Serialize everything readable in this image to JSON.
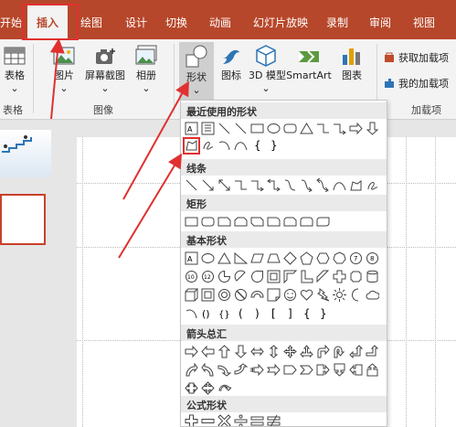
{
  "tabs": [
    "开始",
    "插入",
    "绘图",
    "设计",
    "切换",
    "动画",
    "幻灯片放映",
    "录制",
    "审阅",
    "视图"
  ],
  "ribbon": {
    "table": "表格",
    "picture": "图片",
    "screenshot": "屏幕截图",
    "album": "相册",
    "shapes": "形状",
    "icons": "图标",
    "models3d": "3D 模型",
    "smartart": "SmartArt",
    "chart": "图表",
    "get_addins": "获取加载项",
    "my_addins": "我的加载项",
    "groups": {
      "table": "表格",
      "images": "图像",
      "addins": "加载项"
    }
  },
  "shapes_menu": {
    "recent": "最近使用的形状",
    "lines": "线条",
    "rect": "矩形",
    "basic": "基本形状",
    "arrows": "箭头总汇",
    "formula": "公式形状"
  },
  "colors": {
    "accent": "#b7472a",
    "highlight": "#e03030",
    "ribbon": "#f3f3f3"
  }
}
